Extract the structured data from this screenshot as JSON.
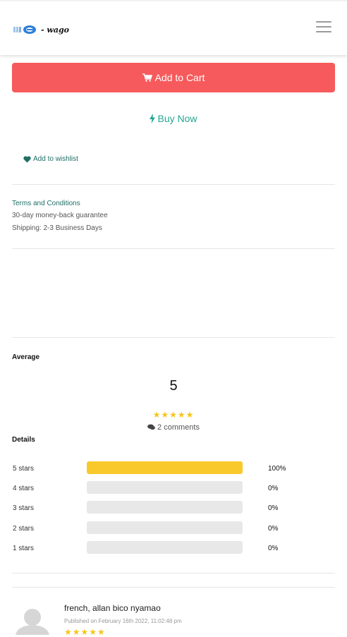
{
  "header": {
    "logo_text": "- wago",
    "menu_icon": "hamburger-icon"
  },
  "actions": {
    "add_to_cart": "Add to Cart",
    "buy_now": "Buy Now",
    "wishlist": "Add to wishlist"
  },
  "policies": {
    "terms": "Terms and Conditions",
    "money_back": "30-day money-back guarantee",
    "shipping": "Shipping: 2-3 Business Days"
  },
  "rating": {
    "average_label": "Average",
    "average_value": "5",
    "stars": "★★★★★",
    "comments": "2 comments",
    "details_label": "Details",
    "rows": [
      {
        "label": "5 stars",
        "percent": "100%",
        "fraction": 1.0
      },
      {
        "label": "4 stars",
        "percent": "0%",
        "fraction": 0
      },
      {
        "label": "3 stars",
        "percent": "0%",
        "fraction": 0
      },
      {
        "label": "2 stars",
        "percent": "0%",
        "fraction": 0
      },
      {
        "label": "1 stars",
        "percent": "0%",
        "fraction": 0
      }
    ]
  },
  "review": {
    "name": "french, allan bico nyamao",
    "date": "Published on February 16th 2022, 11:02:48 pm",
    "stars": "★★★★★"
  },
  "colors": {
    "cart": "#f75a5c",
    "accent": "#25a593",
    "star": "#f5c518",
    "bar": "#f9c92c"
  }
}
